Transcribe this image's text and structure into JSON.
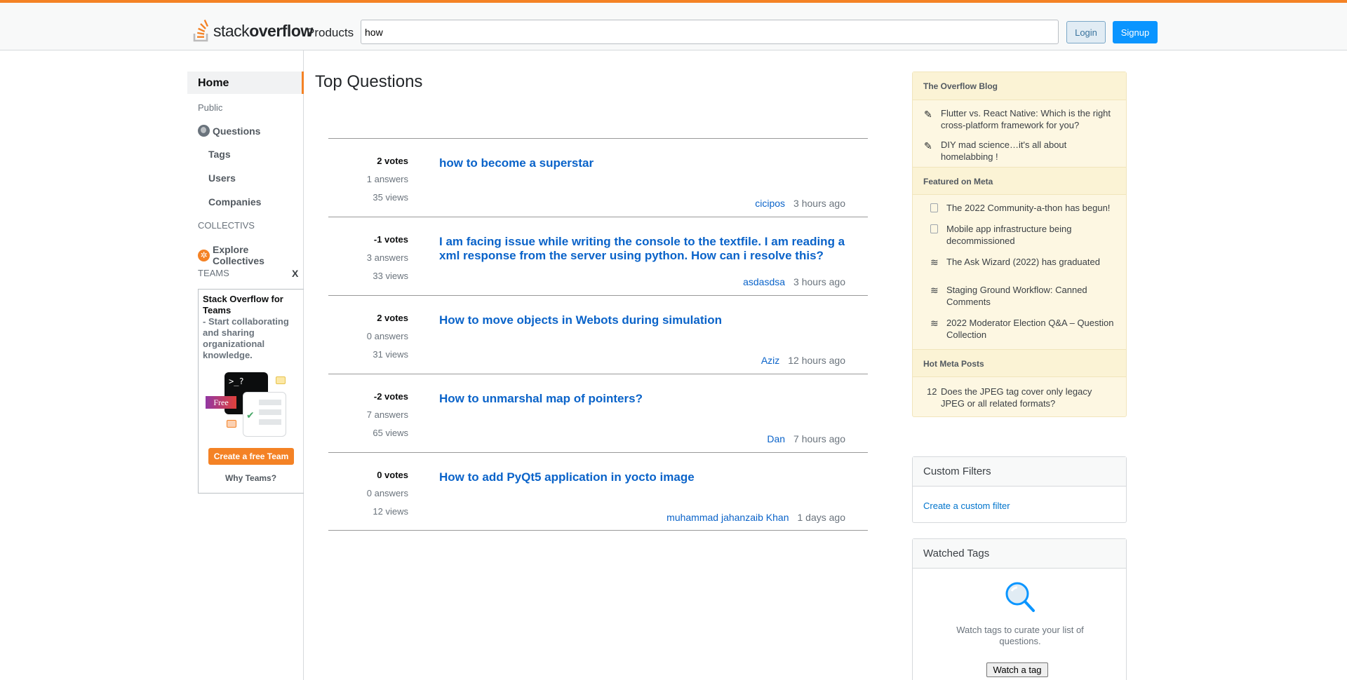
{
  "header": {
    "logo_prefix": "stack",
    "logo_bold": "overflow",
    "products": "Products",
    "search_value": "how",
    "login": "Login",
    "signup": "Signup"
  },
  "leftnav": {
    "home": "Home",
    "public": "Public",
    "questions": "Questions",
    "tags": "Tags",
    "users": "Users",
    "companies": "Companies",
    "collectives_label": "COLLECTIVS",
    "explore_collectives": "Explore Collectives",
    "teams_label": "TEAMS",
    "teams_close": "X",
    "teams_card": {
      "title": "Stack Overflow for Teams",
      "desc": "- Start collaborating and sharing organizational knowledge.",
      "free_badge": "Free",
      "prompt": ">_?",
      "create_button": "Create a free Team",
      "why": "Why Teams?"
    }
  },
  "main": {
    "title": "Top Questions",
    "questions": [
      {
        "votes": "2 votes",
        "answers": "1 answers",
        "views": "35 views",
        "title": "how to become a superstar",
        "user": "cicipos",
        "time": "3 hours ago"
      },
      {
        "votes": "-1 votes",
        "answers": "3 answers",
        "views": "33 views",
        "title": "I am facing issue while writing the console to the textfile. I am reading a xml response from the server using python. How can i resolve this?",
        "user": "asdasdsa",
        "time": "3 hours ago"
      },
      {
        "votes": "2 votes",
        "answers": "0 answers",
        "views": "31 views",
        "title": "How to move objects in Webots during simulation",
        "user": "Aziz",
        "time": "12 hours ago"
      },
      {
        "votes": "-2 votes",
        "answers": "7 answers",
        "views": "65 views",
        "title": "How to unmarshal map of pointers?",
        "user": "Dan",
        "time": "7 hours ago"
      },
      {
        "votes": "0 votes",
        "answers": "0 answers",
        "views": "12 views",
        "title": "How to add PyQt5 application in yocto image",
        "user": "muhammad jahanzaib Khan",
        "time": "1 days ago"
      }
    ]
  },
  "sidebar": {
    "blog_header": "The Overflow Blog",
    "blog_items": [
      "Flutter vs. React Native: Which is the right cross-platform framework for you?",
      "DIY mad science…it's all about homelabbing !"
    ],
    "meta_header": "Featured on Meta",
    "meta_items": [
      "The 2022 Community-a-thon has begun!",
      "Mobile app infrastructure being decommissioned",
      "The Ask Wizard (2022) has graduated",
      "Staging Ground Workflow: Canned Comments",
      "2022 Moderator Election Q&A – Question Collection"
    ],
    "hot_header": "Hot Meta Posts",
    "hot_items": [
      {
        "count": "12",
        "text": "Does the JPEG tag cover only legacy JPEG or all related formats?"
      }
    ],
    "filters_header": "Custom Filters",
    "filters_link": "Create a custom filter",
    "watched_header": "Watched Tags",
    "watched_text": "Watch tags to curate your list of questions.",
    "watch_button": "Watch a tag"
  },
  "colors": {
    "accent_orange": "#f48225",
    "link_blue": "#0a63c9",
    "signup_blue": "#0a95ff",
    "blog_bg": "#fdf7e2"
  }
}
